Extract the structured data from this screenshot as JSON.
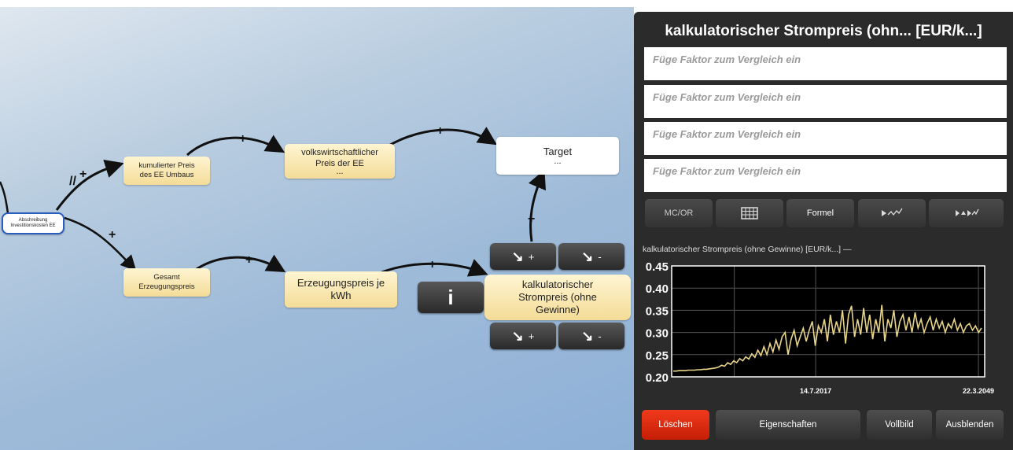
{
  "diagram": {
    "nodes": {
      "abschreibung": "Abschreibung Investitionskosten EE",
      "kumulierter": [
        "kumulierter Preis",
        "des EE Umbaus"
      ],
      "volkswirtschaftlicher": [
        "volkswirtschaftlicher",
        "Preis der EE",
        "..."
      ],
      "target": [
        "Target",
        "..."
      ],
      "gesamt": [
        "Gesamt",
        "Erzeugungspreis"
      ],
      "erzeugungspreis": [
        "Erzeugungspreis je",
        "kWh"
      ],
      "kalkulatorisch": [
        "kalkulatorischer",
        "Strompreis (ohne",
        "Gewinne)"
      ]
    },
    "edge_labels": {
      "plus": "+",
      "delay": "//"
    },
    "node_buttons": {
      "plus": "+",
      "minus": "-",
      "info": "i"
    }
  },
  "panel": {
    "title": "kalkulatorischer Strompreis (ohn... [EUR/k...]",
    "compare_placeholder": "Füge Faktor zum Vergleich ein",
    "tools": {
      "mcor": "MC/OR",
      "formel": "Formel"
    },
    "legend": "kalkulatorischer Strompreis (ohne Gewinne) [EUR/k...] —",
    "bottom": {
      "delete": "Löschen",
      "properties": "Eigenschaften",
      "fullscreen": "Vollbild",
      "hide": "Ausblenden"
    },
    "colors": {
      "series": "#e8d58a",
      "delete": "#e0280e"
    }
  },
  "chart_data": {
    "type": "line",
    "series": [
      {
        "values": [
          0.213,
          0.213,
          0.214,
          0.214,
          0.214,
          0.215,
          0.215,
          0.215,
          0.216,
          0.216,
          0.217,
          0.217,
          0.218,
          0.219,
          0.22,
          0.222,
          0.226,
          0.224,
          0.232,
          0.228,
          0.236,
          0.232,
          0.241,
          0.236,
          0.245,
          0.24,
          0.252,
          0.244,
          0.26,
          0.248,
          0.268,
          0.25,
          0.275,
          0.256,
          0.283,
          0.262,
          0.29,
          0.3,
          0.25,
          0.285,
          0.305,
          0.27,
          0.29,
          0.31,
          0.28,
          0.305,
          0.325,
          0.27,
          0.315,
          0.3,
          0.33,
          0.28,
          0.34,
          0.295,
          0.325,
          0.3,
          0.35,
          0.275,
          0.34,
          0.36,
          0.29,
          0.33,
          0.295,
          0.355,
          0.3,
          0.34,
          0.285,
          0.33,
          0.3,
          0.362,
          0.28,
          0.33,
          0.31,
          0.35,
          0.29,
          0.325,
          0.34,
          0.305,
          0.335,
          0.3,
          0.345,
          0.31,
          0.33,
          0.3,
          0.32,
          0.335,
          0.305,
          0.33,
          0.31,
          0.325,
          0.3,
          0.32,
          0.31,
          0.33,
          0.305,
          0.32,
          0.3,
          0.315,
          0.32,
          0.305,
          0.315,
          0.3,
          0.31
        ]
      }
    ],
    "x_ticks": [
      "14.7.2017",
      "22.3.2049"
    ],
    "y_ticks": [
      "0.45",
      "0.40",
      "0.35",
      "0.30",
      "0.25",
      "0.20"
    ],
    "ylim": [
      0.2,
      0.45
    ],
    "grid": true
  }
}
